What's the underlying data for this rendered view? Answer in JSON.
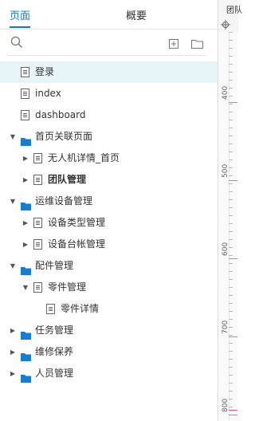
{
  "tabs": {
    "pages": "页面",
    "overview": "概要"
  },
  "tools": [
    "search-icon",
    "add-page-icon",
    "add-folder-icon"
  ],
  "tree": [
    {
      "label": "登录",
      "type": "page",
      "level": 0,
      "selected": true
    },
    {
      "label": "index",
      "type": "page",
      "level": 0
    },
    {
      "label": "dashboard",
      "type": "page",
      "level": 0
    },
    {
      "label": "首页关联页面",
      "type": "folder",
      "level": 0,
      "expanded": true
    },
    {
      "label": "无人机详情_首页",
      "type": "page",
      "level": 1,
      "expandable": true
    },
    {
      "label": "团队管理",
      "type": "page",
      "level": 1,
      "expandable": true,
      "bold": true
    },
    {
      "label": "运维设备管理",
      "type": "folder",
      "level": 0,
      "expanded": true
    },
    {
      "label": "设备类型管理",
      "type": "page",
      "level": 1,
      "expandable": true
    },
    {
      "label": "设备台帐管理",
      "type": "page",
      "level": 1,
      "expandable": true
    },
    {
      "label": "配件管理",
      "type": "folder",
      "level": 0,
      "expanded": true
    },
    {
      "label": "零件管理",
      "type": "page",
      "level": 1,
      "expanded": true
    },
    {
      "label": "零件详情",
      "type": "page",
      "level": 2
    },
    {
      "label": "任务管理",
      "type": "folder",
      "level": 0
    },
    {
      "label": "维修保养",
      "type": "folder",
      "level": 0
    },
    {
      "label": "人员管理",
      "type": "folder",
      "level": 0
    }
  ],
  "ruler": {
    "title": "团队",
    "marks": [
      "400",
      "500",
      "600",
      "700",
      "800"
    ]
  },
  "colors": {
    "accent": "#1677c8",
    "folder": "#1a7cd1",
    "selected_bg": "#e8f5f8"
  }
}
